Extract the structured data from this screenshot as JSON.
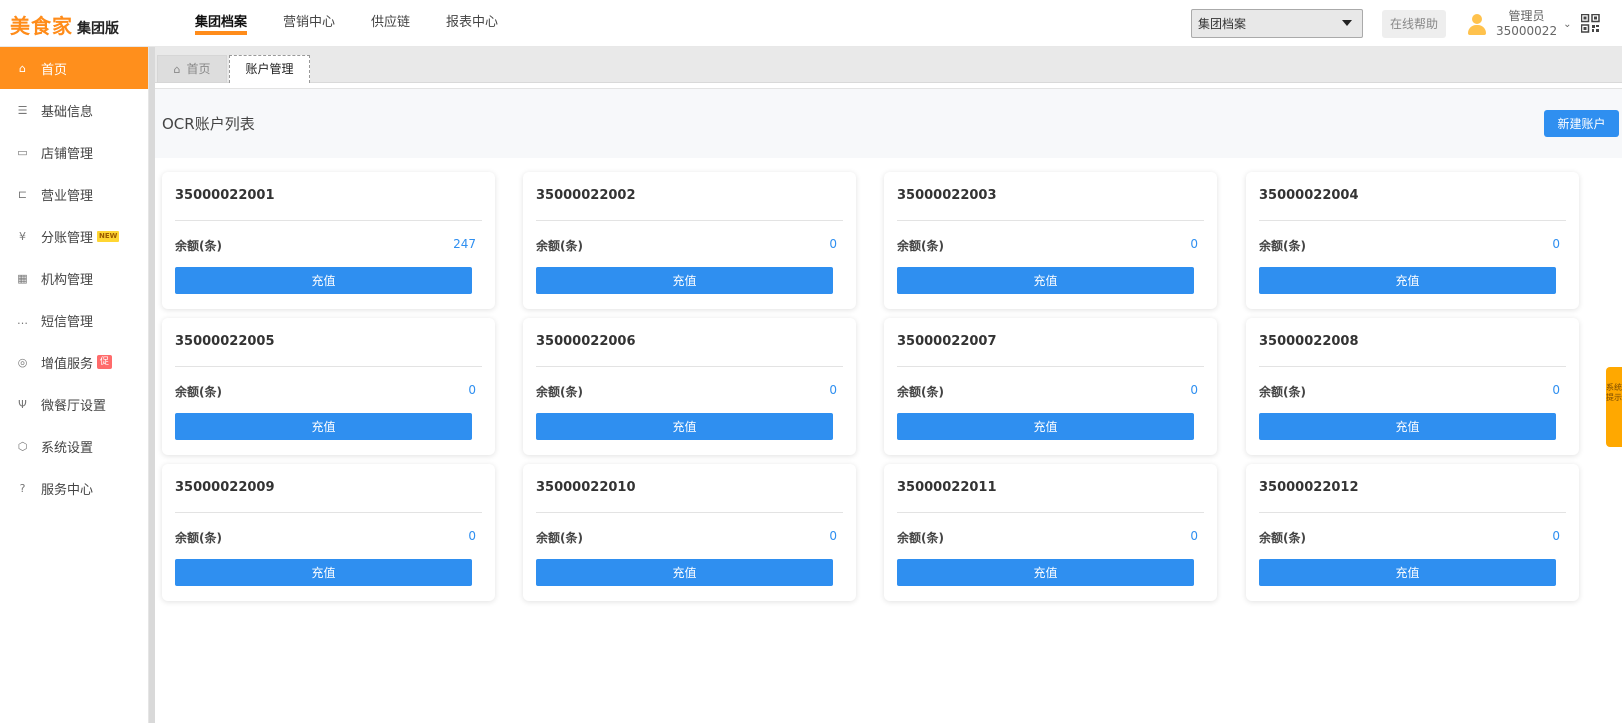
{
  "header": {
    "logo_main": "美食家",
    "logo_sub": "集团版",
    "nav": [
      {
        "label": "集团档案"
      },
      {
        "label": "营销中心"
      },
      {
        "label": "供应链"
      },
      {
        "label": "报表中心"
      }
    ],
    "group_select": "集团档案",
    "help": "在线帮助",
    "user_role": "管理员",
    "user_id": "35000022"
  },
  "sidebar": {
    "items": [
      {
        "label": "首页",
        "icon": "home-icon"
      },
      {
        "label": "基础信息",
        "icon": "document-icon"
      },
      {
        "label": "店铺管理",
        "icon": "store-icon"
      },
      {
        "label": "营业管理",
        "icon": "cart-icon"
      },
      {
        "label": "分账管理",
        "icon": "yuan-icon",
        "badge": "NEW"
      },
      {
        "label": "机构管理",
        "icon": "building-icon"
      },
      {
        "label": "短信管理",
        "icon": "message-icon"
      },
      {
        "label": "增值服务",
        "icon": "gift-icon",
        "badge": "促"
      },
      {
        "label": "微餐厅设置",
        "icon": "cutlery-icon"
      },
      {
        "label": "系统设置",
        "icon": "gear-icon"
      },
      {
        "label": "服务中心",
        "icon": "question-icon"
      }
    ]
  },
  "tabs": {
    "home": "首页",
    "active": "账户管理"
  },
  "panel": {
    "title": "OCR账户列表",
    "new_button": "新建账户"
  },
  "cards": {
    "balance_label": "余额(条)",
    "recharge_label": "充值",
    "items": [
      {
        "id": "35000022001",
        "balance": "247"
      },
      {
        "id": "35000022002",
        "balance": "0"
      },
      {
        "id": "35000022003",
        "balance": "0"
      },
      {
        "id": "35000022004",
        "balance": "0"
      },
      {
        "id": "35000022005",
        "balance": "0"
      },
      {
        "id": "35000022006",
        "balance": "0"
      },
      {
        "id": "35000022007",
        "balance": "0"
      },
      {
        "id": "35000022008",
        "balance": "0"
      },
      {
        "id": "35000022009",
        "balance": "0"
      },
      {
        "id": "35000022010",
        "balance": "0"
      },
      {
        "id": "35000022011",
        "balance": "0"
      },
      {
        "id": "35000022012",
        "balance": "0"
      }
    ]
  },
  "system_tip": "系统提示",
  "colors": {
    "brand": "#ff8c1a",
    "primary": "#2f8ff0",
    "tip": "#ffa800"
  }
}
